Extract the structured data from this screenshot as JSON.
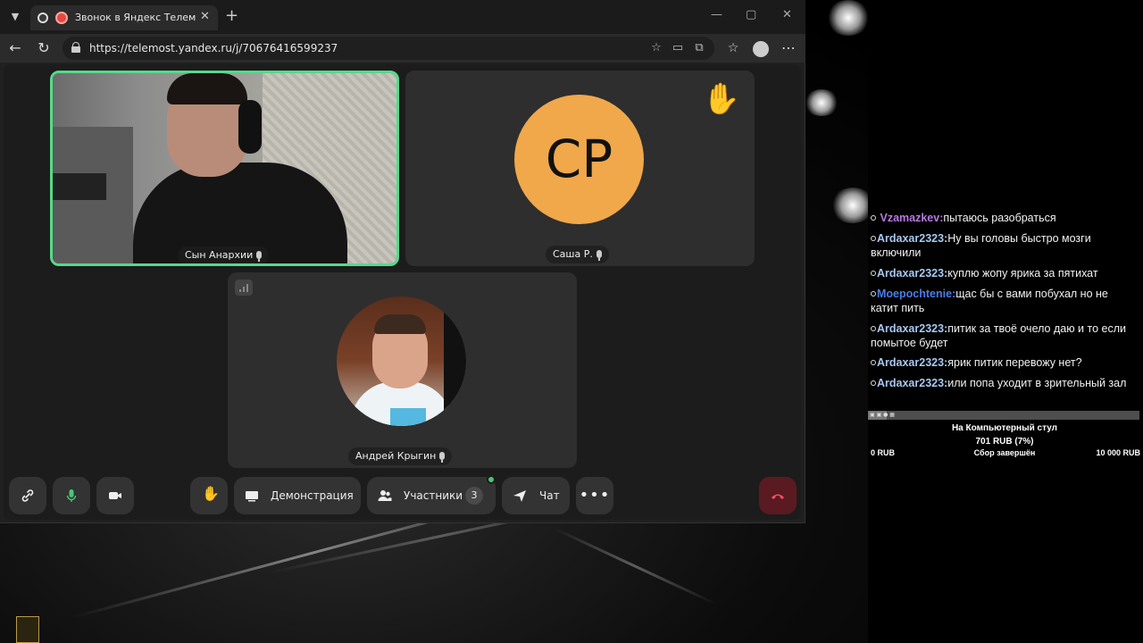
{
  "browser": {
    "tab_title": "Звонок в Яндекс Телемосте",
    "url": "https://telemost.yandex.ru/j/70676416599237"
  },
  "call": {
    "participants": [
      {
        "name": "Сын Анархии",
        "type": "video",
        "speaking": true
      },
      {
        "name": "Саша Р.",
        "initials": "СР",
        "avatar_color": "#f0a84b",
        "hand_raised": true
      },
      {
        "name": "Андрей Крыгин",
        "type": "photo"
      }
    ]
  },
  "toolbar": {
    "screen_share_label": "Демонстрация",
    "participants_label": "Участники",
    "participants_count": "3",
    "chat_label": "Чат",
    "hangup_color": "#5a1a22"
  },
  "stream_chat": {
    "messages": [
      {
        "user": "Vzamazkev:",
        "text": "пытаюсь разобраться",
        "color": "#b57be0"
      },
      {
        "user": "Ardaxar2323:",
        "text": "Ну вы головы быстро мозги включили",
        "color": "#a8c8f0"
      },
      {
        "user": "Ardaxar2323:",
        "text": "куплю жопу ярика за пятихат",
        "color": "#a8c8f0"
      },
      {
        "user": "Moepochtenie:",
        "text": "щас бы с вами побухал но не катит пить",
        "color": "#4b7de8"
      },
      {
        "user": "Ardaxar2323:",
        "text": "питик за твоё очело даю и то если помытое будет",
        "color": "#a8c8f0"
      },
      {
        "user": "Ardaxar2323:",
        "text": "ярик питик перевожу нет?",
        "color": "#a8c8f0"
      },
      {
        "user": "Ardaxar2323:",
        "text": "или попа уходит в зрительный зал",
        "color": "#a8c8f0"
      }
    ]
  },
  "donation_goal": {
    "title": "На Компьютерный стул",
    "amount": "701 RUB (7%)",
    "progress": 0.07,
    "min": "0 RUB",
    "status": "Сбор завершён",
    "max": "10 000 RUB"
  }
}
